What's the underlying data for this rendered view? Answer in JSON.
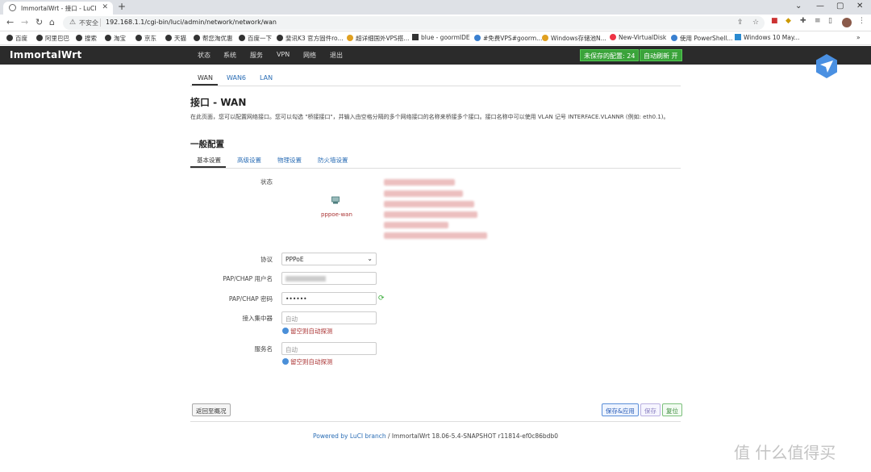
{
  "browser": {
    "tab_title": "ImmortalWrt - 接口 - LuCI",
    "insecure_label": "不安全",
    "url": "192.168.1.1/cgi-bin/luci/admin/network/network/wan",
    "bookmarks": [
      "百度",
      "阿里巴巴",
      "搜索",
      "淘宝",
      "京东",
      "天猫",
      "帮您淘优惠",
      "百度一下",
      "斐讯K3 官方固件ro...",
      "超详细国外VPS搭...",
      "blue - goormIDE",
      "#免费VPS#goorm...",
      "Windows存储池N...",
      "New-VirtualDisk",
      "使用 PowerShell...",
      "Windows 10 May..."
    ]
  },
  "header": {
    "brand": "ImmortalWrt",
    "menu": [
      "状态",
      "系统",
      "服务",
      "VPN",
      "网络",
      "退出"
    ],
    "unsaved": "未保存的配置: 24",
    "autorefresh": "自动刷新 开"
  },
  "tabs": [
    "WAN",
    "WAN6",
    "LAN"
  ],
  "page": {
    "title": "接口 - WAN",
    "description": "在此页面，您可以配置网络接口。您可以勾选 \"桥接接口\"，并输入由空格分隔的多个网络接口的名称来桥接多个接口。接口名称中可以使用 VLAN 记号 INTERFACE.VLANNR (例如: eth0.1)。",
    "section_title": "一般配置",
    "subtabs": [
      "基本设置",
      "高级设置",
      "物理设置",
      "防火墙设置"
    ]
  },
  "form": {
    "status_label": "状态",
    "iface_name": "pppoe-wan",
    "protocol_label": "协议",
    "protocol_value": "PPPoE",
    "username_label": "PAP/CHAP 用户名",
    "password_label": "PAP/CHAP 密码",
    "password_value": "••••••",
    "ac_label": "接入集中器",
    "ac_placeholder": "自动",
    "ac_hint": "留空则自动探测",
    "service_label": "服务名",
    "service_placeholder": "自动",
    "service_hint": "留空则自动探测"
  },
  "buttons": {
    "back": "返回至概况",
    "save_apply": "保存&应用",
    "save": "保存",
    "reset": "复位"
  },
  "footer": {
    "powered": "Powered by LuCI branch",
    "version": " / ImmortalWrt 18.06-5.4-SNAPSHOT r11814-ef0c86bdb0"
  },
  "watermark": "值 什么值得买",
  "colors": {
    "header_bg": "#2b2b2b",
    "accent_link": "#2a6db5",
    "badge_green": "#3aa33a"
  }
}
